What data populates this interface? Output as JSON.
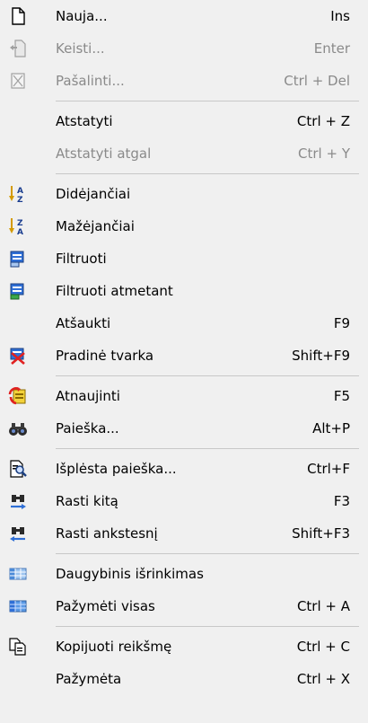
{
  "menu": {
    "items": [
      {
        "label": "Nauja...",
        "shortcut": "Ins",
        "icon": "new-document-icon"
      },
      {
        "label": "Keisti...",
        "shortcut": "Enter",
        "icon": "edit-document-icon",
        "disabled": true
      },
      {
        "label": "Pašalinti...",
        "shortcut": "Ctrl + Del",
        "icon": "delete-document-icon",
        "disabled": true
      },
      {
        "label": "Atstatyti",
        "shortcut": "Ctrl + Z"
      },
      {
        "label": "Atstatyti atgal",
        "shortcut": "Ctrl + Y",
        "disabled": true
      },
      {
        "label": "Didėjančiai",
        "shortcut": "",
        "icon": "sort-ascending-icon"
      },
      {
        "label": "Mažėjančiai",
        "shortcut": "",
        "icon": "sort-descending-icon"
      },
      {
        "label": "Filtruoti",
        "shortcut": "",
        "icon": "filter-icon"
      },
      {
        "label": "Filtruoti atmetant",
        "shortcut": "",
        "icon": "filter-exclude-icon"
      },
      {
        "label": "Atšaukti",
        "shortcut": "F9"
      },
      {
        "label": "Pradinė tvarka",
        "shortcut": "Shift+F9",
        "icon": "reset-order-icon"
      },
      {
        "label": "Atnaujinti",
        "shortcut": "F5",
        "icon": "refresh-icon"
      },
      {
        "label": "Paieška...",
        "shortcut": "Alt+P",
        "icon": "binoculars-icon"
      },
      {
        "label": "Išplėsta paieška...",
        "shortcut": "Ctrl+F",
        "icon": "advanced-search-icon"
      },
      {
        "label": "Rasti kitą",
        "shortcut": "F3",
        "icon": "find-next-icon"
      },
      {
        "label": "Rasti ankstesnį",
        "shortcut": "Shift+F3",
        "icon": "find-previous-icon"
      },
      {
        "label": "Daugybinis išrinkimas",
        "shortcut": "",
        "icon": "multi-select-icon"
      },
      {
        "label": "Pažymėti visas",
        "shortcut": "Ctrl + A",
        "icon": "select-all-icon"
      },
      {
        "label": "Kopijuoti reikšmę",
        "shortcut": "Ctrl + C",
        "icon": "copy-icon"
      },
      {
        "label": "Pažymėta",
        "shortcut": "Ctrl + X"
      }
    ]
  }
}
